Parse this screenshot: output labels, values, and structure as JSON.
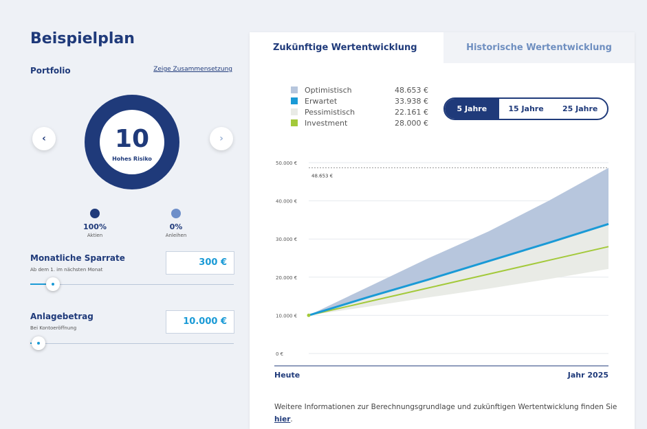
{
  "plan": {
    "title": "Beispielplan",
    "portfolio_label": "Portfolio",
    "composition_link": "Zeige Zusammensetzung",
    "risk_level": "10",
    "risk_label": "Hohes Risiko",
    "nav_prev": "‹",
    "nav_next": "›",
    "allocations": [
      {
        "percent": "100%",
        "label": "Aktien",
        "color": "#1f3a7a"
      },
      {
        "percent": "0%",
        "label": "Anleihen",
        "color": "#6e8fc9"
      }
    ],
    "monthly": {
      "title": "Monatliche Sparrate",
      "subtitle": "Ab dem 1. im nächsten Monat",
      "value": "300 €",
      "slider_fraction": 0.07
    },
    "initial": {
      "title": "Anlagebetrag",
      "subtitle": "Bei Kontoeröffnung",
      "value": "10.000 €",
      "slider_fraction": 0.0
    }
  },
  "tabs": [
    "Zukünftige Wertentwicklung",
    "Historische Wertentwicklung"
  ],
  "legend": [
    {
      "name": "Optimistisch",
      "value": "48.653 €",
      "color": "#b7c6dd"
    },
    {
      "name": "Erwartet",
      "value": "33.938 €",
      "color": "#1a9ad6"
    },
    {
      "name": "Pessimistisch",
      "value": "22.161 €",
      "color": "#e9ebe6"
    },
    {
      "name": "Investment",
      "value": "28.000 €",
      "color": "#a3c93a"
    }
  ],
  "periods": [
    {
      "label": "5 Jahre",
      "active": true
    },
    {
      "label": "15 Jahre",
      "active": false
    },
    {
      "label": "25 Jahre",
      "active": false
    }
  ],
  "chart_data": {
    "type": "area",
    "x": [
      0,
      1,
      2,
      3,
      4,
      5
    ],
    "x_start_label": "Heute",
    "x_end_label": "Jahr 2025",
    "yticks": [
      "0 €",
      "10.000 €",
      "20.000 €",
      "30.000 €",
      "40.000 €",
      "50.000 €"
    ],
    "ylim": [
      0,
      50000
    ],
    "max_annotation": "48.653 €",
    "max_value": 48653,
    "series": [
      {
        "name": "Optimistisch",
        "values": [
          10000,
          17500,
          25000,
          32000,
          40000,
          48653
        ],
        "color": "#b7c6dd"
      },
      {
        "name": "Erwartet",
        "values": [
          10000,
          14800,
          19400,
          24200,
          29000,
          33938
        ],
        "color": "#1a9ad6"
      },
      {
        "name": "Pessimistisch",
        "values": [
          10000,
          12300,
          14700,
          17000,
          19500,
          22161
        ],
        "color": "#e9ebe6"
      },
      {
        "name": "Investment",
        "values": [
          10000,
          13600,
          17200,
          20800,
          24400,
          28000
        ],
        "color": "#a3c93a"
      }
    ]
  },
  "footnote": {
    "text": "Weitere Informationen zur Berechnungsgrundlage und zukünftigen Wertentwicklung finden Sie ",
    "link": "hier",
    "end": "."
  }
}
